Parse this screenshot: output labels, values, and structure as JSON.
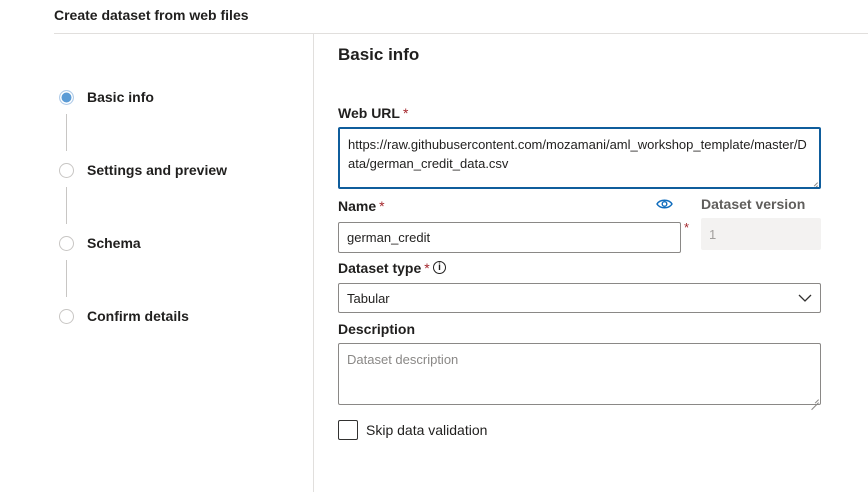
{
  "header": {
    "title": "Create dataset from web files"
  },
  "steps": [
    {
      "label": "Basic info",
      "active": true
    },
    {
      "label": "Settings and preview",
      "active": false
    },
    {
      "label": "Schema",
      "active": false
    },
    {
      "label": "Confirm details",
      "active": false
    }
  ],
  "form": {
    "section_title": "Basic info",
    "web_url": {
      "label": "Web URL",
      "required_mark": "*",
      "value": "https://raw.githubusercontent.com/mozamani/aml_workshop_template/master/Data/german_credit_data.csv"
    },
    "name": {
      "label": "Name",
      "required_mark": "*",
      "value": "german_credit",
      "side_mark": "*"
    },
    "dataset_version": {
      "label": "Dataset version",
      "value": "1"
    },
    "dataset_type": {
      "label": "Dataset type",
      "required_mark": "*",
      "info_glyph": "i",
      "selected": "Tabular"
    },
    "description": {
      "label": "Description",
      "placeholder": "Dataset description"
    },
    "skip_validation": {
      "label": "Skip data validation",
      "checked": false
    }
  },
  "colors": {
    "accent": "#0f5d9c",
    "step_active": "#5b9bd5",
    "required": "#a4262c"
  },
  "icons": [
    "eye-icon",
    "info-icon",
    "chevron-down-icon"
  ]
}
